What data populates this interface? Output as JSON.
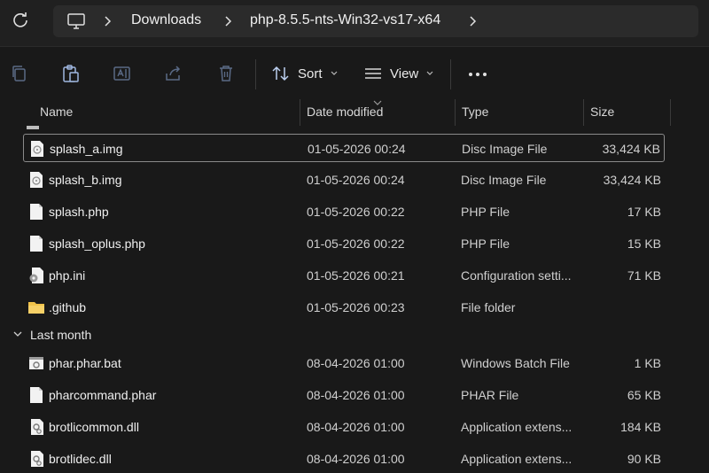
{
  "breadcrumb": {
    "items": [
      "Downloads",
      "php-8.5.5-nts-Win32-vs17-x64"
    ]
  },
  "toolbar": {
    "sort_label": "Sort",
    "view_label": "View"
  },
  "columns": {
    "name": "Name",
    "date": "Date modified",
    "type": "Type",
    "size": "Size"
  },
  "groups": {
    "last_month": "Last month"
  },
  "files_recent": [
    {
      "name": "splash_a.img",
      "date": "01-05-2026 00:24",
      "type": "Disc Image File",
      "size": "33,424 KB",
      "icon": "disc-image-file-icon"
    },
    {
      "name": "splash_b.img",
      "date": "01-05-2026 00:24",
      "type": "Disc Image File",
      "size": "33,424 KB",
      "icon": "disc-image-file-icon"
    },
    {
      "name": "splash.php",
      "date": "01-05-2026 00:22",
      "type": "PHP File",
      "size": "17 KB",
      "icon": "php-file-icon"
    },
    {
      "name": "splash_oplus.php",
      "date": "01-05-2026 00:22",
      "type": "PHP File",
      "size": "15 KB",
      "icon": "php-file-icon"
    },
    {
      "name": "php.ini",
      "date": "01-05-2026 00:21",
      "type": "Configuration setti...",
      "size": "71 KB",
      "icon": "config-file-icon"
    },
    {
      "name": ".github",
      "date": "01-05-2026 00:23",
      "type": "File folder",
      "size": "",
      "icon": "folder-icon"
    }
  ],
  "files_last_month": [
    {
      "name": "phar.phar.bat",
      "date": "08-04-2026 01:00",
      "type": "Windows Batch File",
      "size": "1 KB",
      "icon": "batch-file-icon"
    },
    {
      "name": "pharcommand.phar",
      "date": "08-04-2026 01:00",
      "type": "PHAR File",
      "size": "65 KB",
      "icon": "phar-file-icon"
    },
    {
      "name": "brotlicommon.dll",
      "date": "08-04-2026 01:00",
      "type": "Application extens...",
      "size": "184 KB",
      "icon": "dll-file-icon"
    },
    {
      "name": "brotlidec.dll",
      "date": "08-04-2026 01:00",
      "type": "Application extens...",
      "size": "90 KB",
      "icon": "dll-file-icon"
    }
  ],
  "colors": {
    "background": "#191919",
    "titlebar": "#202020",
    "breadcrumb_bg": "#2b2b2b",
    "folder": "#f0c24a"
  }
}
